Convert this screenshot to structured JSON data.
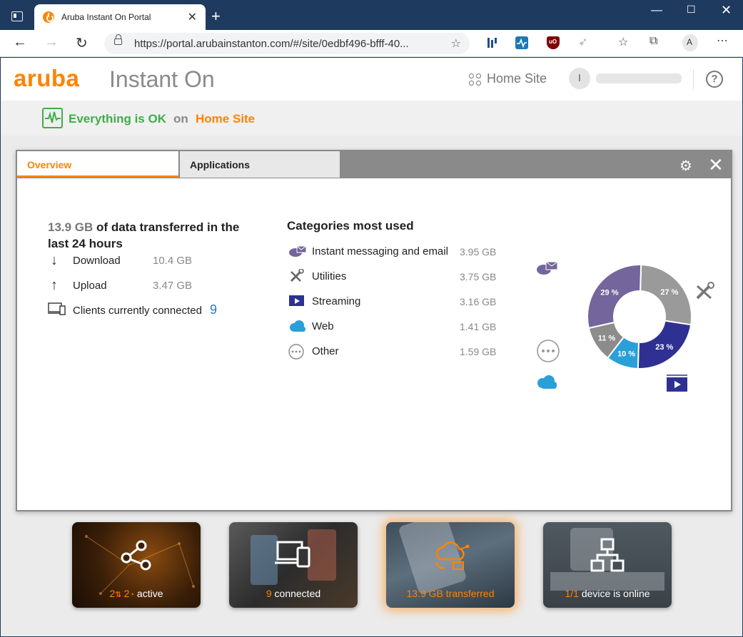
{
  "browser": {
    "tab_title": "Aruba Instant On Portal",
    "url": "https://portal.arubainstanton.com/#/site/0edbf496-bfff-40..."
  },
  "header": {
    "brand_aruba": "aruba",
    "brand_instant": "Instant On",
    "site_name": "Home Site",
    "avatar_initial": "I",
    "help": "?"
  },
  "status": {
    "text": "Everything is OK",
    "on": "on",
    "site": "Home Site"
  },
  "tabs": {
    "overview": "Overview",
    "applications": "Applications"
  },
  "overview": {
    "total": "13.9 GB",
    "total_suffix": "of data transferred in the last 24 hours",
    "download_label": "Download",
    "download_value": "10.4 GB",
    "upload_label": "Upload",
    "upload_value": "3.47 GB",
    "clients_label": "Clients currently connected",
    "clients_value": "9"
  },
  "categories": {
    "title": "Categories most used",
    "items": [
      {
        "label": "Instant messaging and email",
        "value": "3.95 GB",
        "icon": "chat-mail-icon"
      },
      {
        "label": "Utilities",
        "value": "3.75 GB",
        "icon": "tools-icon"
      },
      {
        "label": "Streaming",
        "value": "3.16 GB",
        "icon": "video-icon"
      },
      {
        "label": "Web",
        "value": "1.41 GB",
        "icon": "cloud-icon"
      },
      {
        "label": "Other",
        "value": "1.59 GB",
        "icon": "more-icon"
      }
    ]
  },
  "chart_data": {
    "type": "pie",
    "categories": [
      "Instant messaging and email",
      "Utilities",
      "Streaming",
      "Web",
      "Other"
    ],
    "values": [
      29,
      27,
      23,
      10,
      11
    ],
    "labels": [
      "29 %",
      "27 %",
      "23 %",
      "10 %",
      "11 %"
    ],
    "colors": [
      "#74659c",
      "#9a9a9a",
      "#2e3192",
      "#2a9fd8",
      "#8c8c8c"
    ]
  },
  "cards": [
    {
      "num1": "2",
      "num2": "2",
      "text": "active"
    },
    {
      "num": "9",
      "text": "connected"
    },
    {
      "num": "13.9 GB",
      "text": "transferred"
    },
    {
      "num": "1/1",
      "text": "device is online"
    }
  ]
}
